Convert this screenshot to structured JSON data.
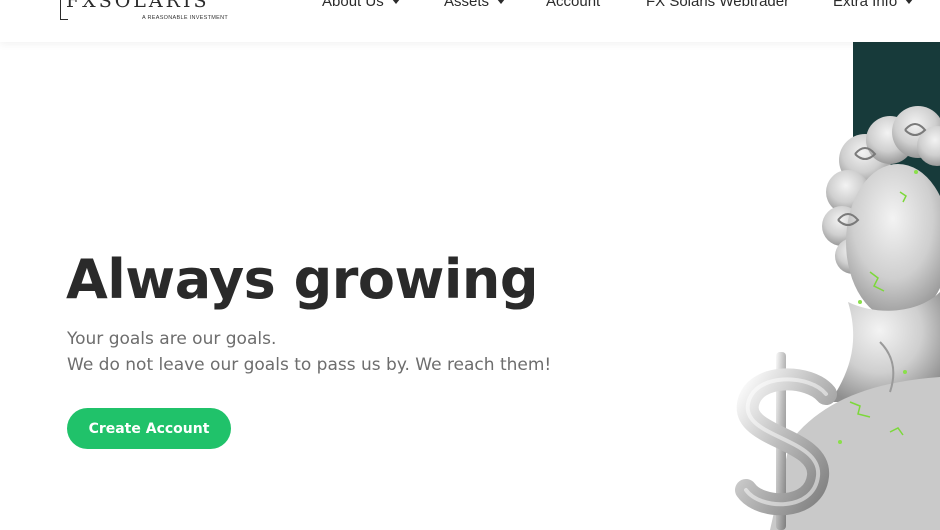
{
  "header": {
    "logo_text": "FXSOLARIS",
    "logo_tagline": "A REASONABLE INVESTMENT",
    "nav": [
      {
        "label": "About Us",
        "has_dropdown": true
      },
      {
        "label": "Assets",
        "has_dropdown": true
      },
      {
        "label": "Account",
        "has_dropdown": false
      },
      {
        "label": "FX Solaris Webtrader",
        "has_dropdown": false
      },
      {
        "label": "Extra Info",
        "has_dropdown": true
      }
    ]
  },
  "hero": {
    "title": "Always growing",
    "subtitle_line1": "Your goals are our goals.",
    "subtitle_line2": "We do not leave our goals to pass us by. We reach them!",
    "cta_label": "Create Account"
  },
  "colors": {
    "accent": "#20c26a",
    "dark_panel": "#173a3a",
    "text_dark": "#2a2a2a",
    "text_muted": "#6d6d6d"
  },
  "art": {
    "icons": [
      "statue-bust-icon",
      "dollar-sign-icon"
    ]
  }
}
